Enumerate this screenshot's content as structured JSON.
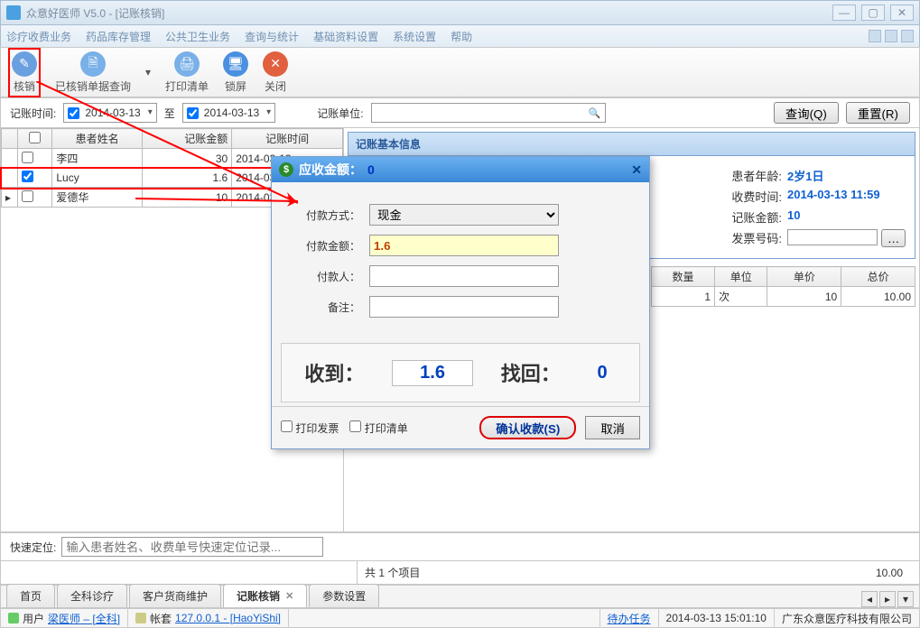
{
  "window": {
    "title": "众意好医师 V5.0 - [记账核销]",
    "win_min": "—",
    "win_max": "▢",
    "win_close": "✕"
  },
  "menu": {
    "items": [
      "诊疗收费业务",
      "药品库存管理",
      "公共卫生业务",
      "查询与统计",
      "基础资料设置",
      "系统设置",
      "帮助"
    ]
  },
  "toolbar": {
    "hexiao": "核销",
    "query_verified": "已核销单据查询",
    "print_list": "打印清单",
    "lock": "锁屏",
    "close": "关闭"
  },
  "filter": {
    "time_label": "记账时间:",
    "date_from": "2014-03-13",
    "to_label": "至",
    "date_to": "2014-03-13",
    "unit_label": "记账单位:",
    "unit_value": "",
    "query_btn": "查询(Q)",
    "reset_btn": "重置(R)"
  },
  "table": {
    "cols": [
      "",
      "患者姓名",
      "记账金额",
      "记账时间"
    ],
    "rows": [
      {
        "checked": false,
        "name": "李四",
        "amount": "30",
        "time": "2014-03-13"
      },
      {
        "checked": true,
        "name": "Lucy",
        "amount": "1.6",
        "time": "2014-03-13"
      },
      {
        "checked": false,
        "name": "爱德华",
        "amount": "10",
        "time": "2014-03-13"
      }
    ]
  },
  "right": {
    "group_title": "记账基本信息",
    "age_label": "患者年龄:",
    "age_value": "2岁1日",
    "charge_time_label": "收费时间:",
    "charge_time_value": "2014-03-13 11:59",
    "amount_label": "记账金额:",
    "amount_value": "10",
    "invoice_label": "发票号码:",
    "invoice_value": "",
    "more": "…"
  },
  "items": {
    "cols": [
      "数量",
      "单位",
      "单价",
      "总价"
    ],
    "row": {
      "qty": "1",
      "unit": "次",
      "price": "10",
      "total": "10.00"
    }
  },
  "quick": {
    "label": "快速定位:",
    "placeholder": "输入患者姓名、收费单号快速定位记录..."
  },
  "summary": {
    "count_text": "共 1 个项目",
    "total": "10.00"
  },
  "tabs": {
    "items": [
      "首页",
      "全科诊疗",
      "客户货商维护",
      "记账核销",
      "参数设置"
    ],
    "active_index": 3
  },
  "status": {
    "user_label": "用户",
    "user_name": "梁医师 – [全科]",
    "account_label": "帐套",
    "account_value": "127.0.0.1 - [HaoYiShi]",
    "todo_label": "待办任务",
    "datetime": "2014-03-13 15:01:10",
    "company": "广东众意医疗科技有限公司"
  },
  "modal": {
    "title_label": "应收金额：",
    "title_amt": "0",
    "pay_method_label": "付款方式：",
    "pay_method_value": "现金",
    "pay_amount_label": "付款金额：",
    "pay_amount_value": "1.6",
    "payer_label": "付款人：",
    "payer_value": "",
    "remark_label": "备注：",
    "remark_value": "",
    "received_label": "收到：",
    "received_value": "1.6",
    "change_label": "找回：",
    "change_value": "0",
    "print_invoice": "打印发票",
    "print_list": "打印清单",
    "confirm_btn": "确认收款(S)",
    "cancel_btn": "取消"
  }
}
